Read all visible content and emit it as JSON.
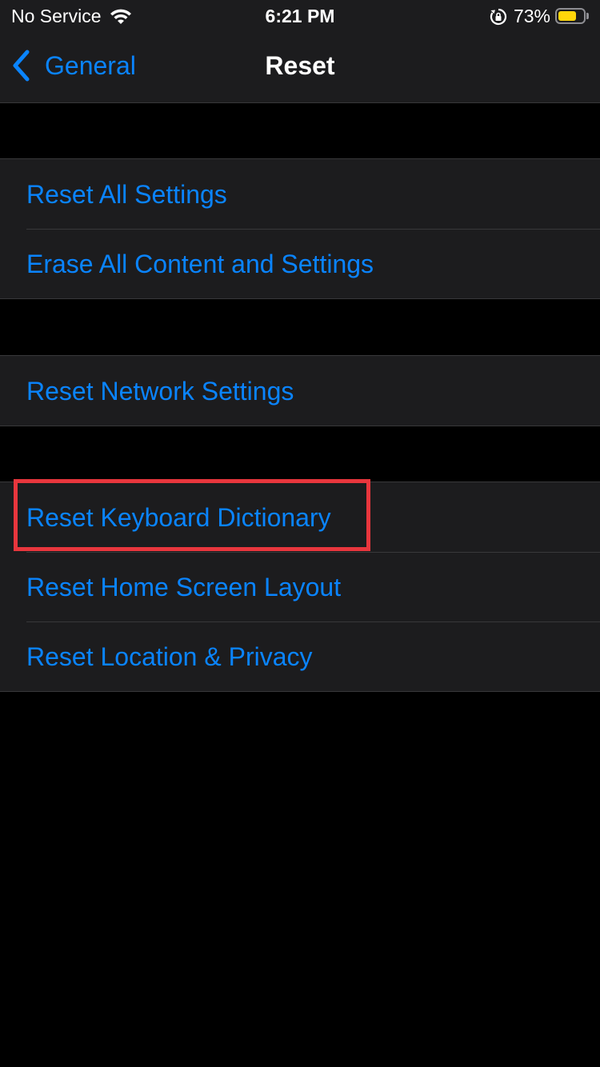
{
  "status_bar": {
    "carrier": "No Service",
    "time": "6:21 PM",
    "battery_percent": "73%",
    "battery_level": 0.73,
    "battery_color": "#ffd60a",
    "icons": [
      "wifi-icon",
      "orientation-lock-icon",
      "battery-icon"
    ]
  },
  "nav": {
    "back_label": "General",
    "title": "Reset",
    "accent_color": "#0a84ff"
  },
  "groups": [
    {
      "items": [
        {
          "label": "Reset All Settings"
        },
        {
          "label": "Erase All Content and Settings"
        }
      ]
    },
    {
      "items": [
        {
          "label": "Reset Network Settings"
        }
      ]
    },
    {
      "items": [
        {
          "label": "Reset Keyboard Dictionary",
          "highlighted": true,
          "highlight_color": "#e8363d"
        },
        {
          "label": "Reset Home Screen Layout"
        },
        {
          "label": "Reset Location & Privacy"
        }
      ]
    }
  ]
}
